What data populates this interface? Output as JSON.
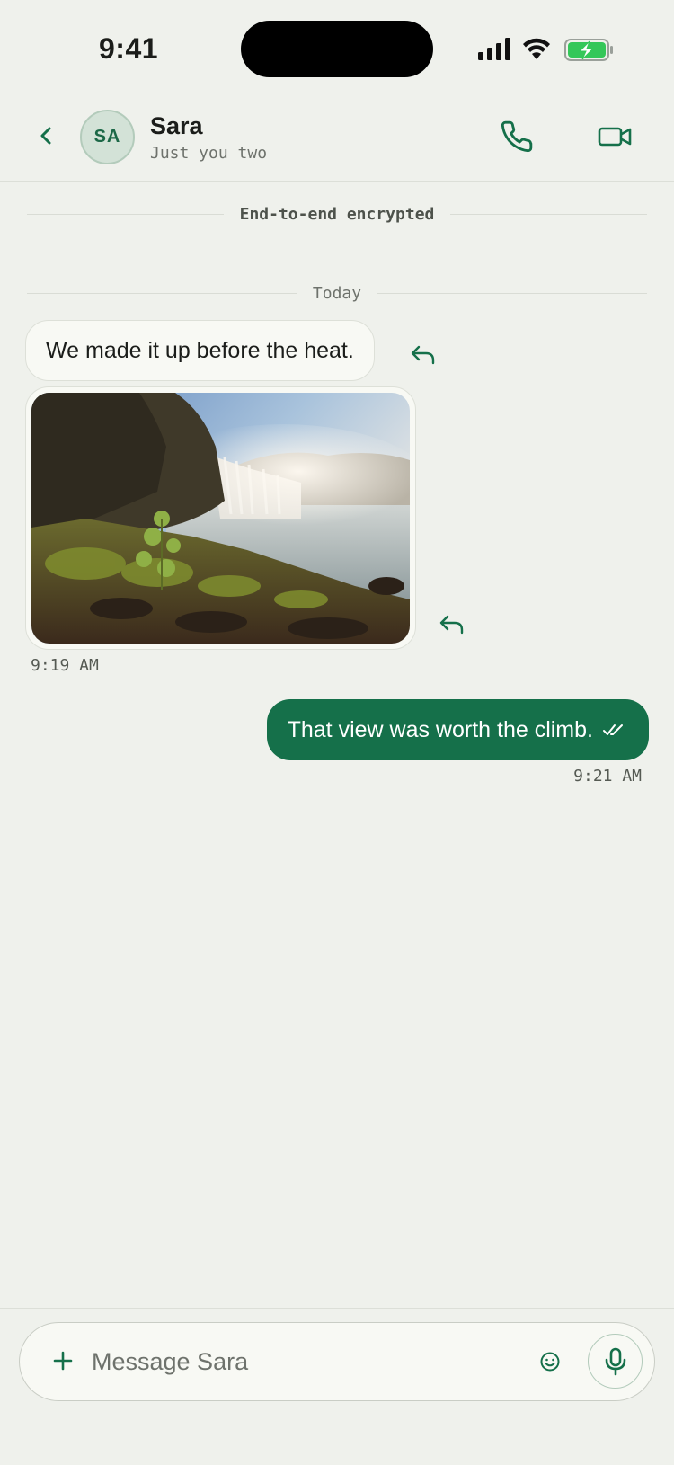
{
  "status_bar": {
    "time": "9:41",
    "icons": [
      "cellular-signal-icon",
      "wifi-icon",
      "battery-charging-icon"
    ]
  },
  "header": {
    "back_icon": "chevron-left-icon",
    "avatar_initials": "SA",
    "contact_name": "Sara",
    "contact_subtitle": "Just you two",
    "call_icon": "phone-icon",
    "video_icon": "video-camera-icon"
  },
  "chat": {
    "encryption_notice": "End-to-end encrypted",
    "date_separator": "Today",
    "messages": [
      {
        "direction": "incoming",
        "type": "text",
        "text": "We made it up before the heat."
      },
      {
        "direction": "incoming",
        "type": "image",
        "image_description_icon": "waterfall-photo",
        "timestamp": "9:19 AM"
      },
      {
        "direction": "outgoing",
        "type": "text",
        "text": "That view was worth the climb.",
        "status_icon": "double-check-icon",
        "timestamp": "9:21 AM"
      }
    ]
  },
  "composer": {
    "placeholder": "Message Sara",
    "value": "",
    "icons": [
      "plus-icon",
      "emoji-icon",
      "microphone-icon"
    ]
  },
  "colors": {
    "background": "#eff1ec",
    "accent": "#15704a",
    "avatar_bg": "#d3e2d7",
    "battery_green": "#34c759"
  }
}
